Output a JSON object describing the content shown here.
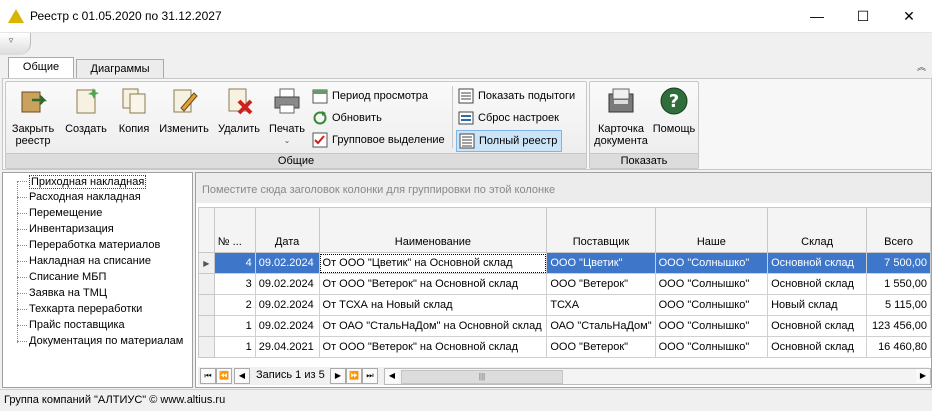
{
  "window": {
    "title": "Реестр с 01.05.2020 по 31.12.2027",
    "minimize": "—",
    "maximize": "☐",
    "close": "✕"
  },
  "qat": {
    "button": "▿"
  },
  "tabs": [
    {
      "label": "Общие"
    },
    {
      "label": "Диаграммы"
    }
  ],
  "ribbon": {
    "collapse": "︽",
    "groups": {
      "general": "Общие",
      "show": "Показать"
    },
    "buttons": {
      "close_registry": "Закрыть реестр",
      "create": "Создать",
      "copy": "Копия",
      "edit": "Изменить",
      "delete": "Удалить",
      "print": "Печать",
      "view_period": "Период просмотра",
      "refresh": "Обновить",
      "group_select": "Групповое выделение",
      "show_subtotals": "Показать подытоги",
      "reset_settings": "Сброс настроек",
      "full_registry": "Полный реестр",
      "doc_card": "Карточка документа",
      "help": "Помощь"
    }
  },
  "tree": {
    "items": [
      "Приходная накладная",
      "Расходная накладная",
      "Перемещение",
      "Инвентаризация",
      "Переработка материалов",
      "Накладная на списание",
      "Списание МБП",
      "Заявка на ТМЦ",
      "Техкарта переработки",
      "Прайс поставщика",
      "Документация по материалам"
    ]
  },
  "grid": {
    "group_hint": "Поместите сюда заголовок колонки для группировки по этой колонке",
    "columns": [
      "№ ...",
      "Дата",
      "Наименование",
      "Поставщик",
      "Наше",
      "Склад",
      "Всего"
    ],
    "rows": [
      [
        "4",
        "09.02.2024",
        "От ООО \"Цветик\" на Основной склад",
        "ООО \"Цветик\"",
        "ООО \"Солнышко\"",
        "Основной склад",
        "7 500,00"
      ],
      [
        "3",
        "09.02.2024",
        "От ООО \"Ветерок\" на Основной склад",
        "ООО \"Ветерок\"",
        "ООО \"Солнышко\"",
        "Основной склад",
        "1 550,00"
      ],
      [
        "2",
        "09.02.2024",
        "От ТСХА на Новый склад",
        "ТСХА",
        "ООО \"Солнышко\"",
        "Новый склад",
        "5 115,00"
      ],
      [
        "1",
        "09.02.2024",
        "От ОАО \"СтальНаДом\" на Основной склад",
        "ОАО \"СтальНаДом\"",
        "ООО \"Солнышко\"",
        "Основной склад",
        "123 456,00"
      ],
      [
        "1",
        "29.04.2021",
        "От ООО \"Ветерок\" на Основной склад",
        "ООО \"Ветерок\"",
        "ООО \"Солнышко\"",
        "Основной склад",
        "16 460,80"
      ]
    ],
    "record_info": "Запись 1 из 5"
  },
  "status": {
    "text": "Группа компаний \"АЛТИУС\" © www.altius.ru"
  }
}
